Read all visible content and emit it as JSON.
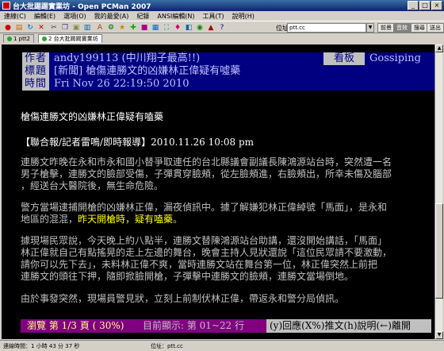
{
  "window": {
    "title": "台大批踢踢實業坊 - Open PCMan 2007"
  },
  "menu": [
    "連線(C)",
    "編輯(E)",
    "選項(O)",
    "我的最愛(A)",
    "紀錄",
    "ANSI編輯(N)",
    "工具(T)",
    "說明(H)"
  ],
  "toolbar": {
    "address_label": "位址:",
    "address_value": "ptt.cc",
    "btn_front": "前景",
    "btn_sound": "音效",
    "btn_find": "搜尋",
    "btn_exit": "送出"
  },
  "tabs": [
    {
      "label": "1 ptt2"
    },
    {
      "label": "2 台大批踢踢實業坊"
    }
  ],
  "header": {
    "author_label": "作者",
    "author": "andy199113 (中川翔子最高!!)",
    "board_label": "看板",
    "board": "Gossiping",
    "title_label": "標題",
    "title": "[新聞] 槍傷連勝文的凶嫌林正偉疑有噓藥",
    "time_label": "時間",
    "time": "Fri Nov 26 22:19:50 2010"
  },
  "article": {
    "heading": "槍傷連勝文的凶嫌林正偉疑有嗑藥",
    "byline": "【聯合報/記者雷鳴/即時報導】2010.11.26 10:08 pm",
    "p1": [
      "連勝文昨晚在永和市永和國小替爭取連任的台北縣議會副議長陳鴻源站台時，突然遭一名",
      "男子槍擊，連勝文的臉部受傷，子彈貫穿臉頰，從左臉頰進，右臉頰出，所幸未傷及腦部",
      "，經送台大醫院後，無生命危險。"
    ],
    "p2a": "警方當場逮捕開槍的凶嫌林正偉，漏夜偵訊中。據了解嫌犯林正偉綽號「馬面」，是永和",
    "p2b_pre": "地區的混混，",
    "p2b_hl": "昨天開槍時，疑有嗑藥",
    "p2b_post": "。",
    "p3": [
      "據現場民眾說，今天晚上約八點半，連勝文替陳鴻源站台助講，還沒開始講話，「馬面」",
      "林正偉就自己有點搖晃的走上左邊的舞台，晚會主持人見狀還說「這位民眾請不要激動，",
      "請你可以先下去」，未料林正偉不爽，當時連勝文站在舞台第一位，林正偉突然上前把",
      "連勝文的頭往下押，隨即掀臉開槍，子彈擊中連勝文的臉頰，連勝文當場倒地。"
    ],
    "p4": "由於事發突然，現場員警見狀，立刻上前制伏林正偉，帶返永和警分局偵訊。"
  },
  "status": {
    "browse": "瀏覽 第 1/3 頁 ( 30%)",
    "lines": "目前顯示: 第 01~22 行",
    "keys": "(y)回應(X%)推文(h)說明(←)離開"
  },
  "statusbar": {
    "conn": "連線時間：1 小時 43 分 37 秒",
    "host": "位址：ptt.cc"
  },
  "colors": {
    "term_bg": "#000000",
    "header_bg": "#000080",
    "highlight": "#ffff00",
    "status_bg": "#800080"
  }
}
